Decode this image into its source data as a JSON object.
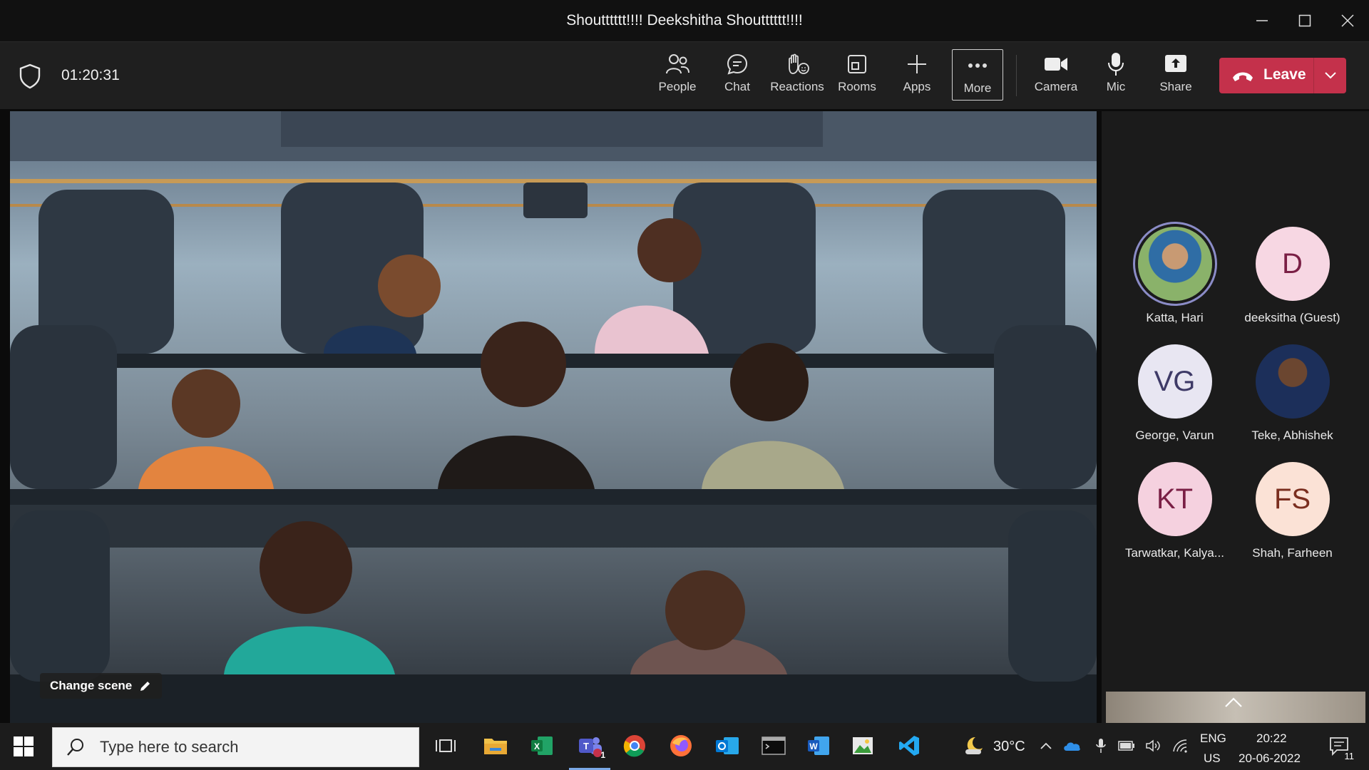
{
  "window": {
    "title": "Shoutttttt!!!! Deekshitha Shoutttttt!!!!"
  },
  "meeting": {
    "timer": "01:20:31",
    "tools": [
      {
        "label": "People",
        "icon": "people-icon"
      },
      {
        "label": "Chat",
        "icon": "chat-icon"
      },
      {
        "label": "Reactions",
        "icon": "reactions-icon"
      },
      {
        "label": "Rooms",
        "icon": "rooms-icon"
      },
      {
        "label": "Apps",
        "icon": "apps-plus-icon"
      },
      {
        "label": "More",
        "icon": "more-dots-icon"
      },
      {
        "label": "Camera",
        "icon": "camera-icon"
      },
      {
        "label": "Mic",
        "icon": "mic-icon"
      },
      {
        "label": "Share",
        "icon": "share-icon"
      }
    ],
    "leave_label": "Leave",
    "accent": "#c4314b"
  },
  "stage": {
    "change_scene_label": "Change scene"
  },
  "roster": {
    "participants": [
      {
        "name": "Katta, Hari",
        "initials": "",
        "kind": "photo"
      },
      {
        "name": "deeksitha (Guest)",
        "initials": "D",
        "kind": "initials"
      },
      {
        "name": "George, Varun",
        "initials": "VG",
        "kind": "initials"
      },
      {
        "name": "Teke, Abhishek",
        "initials": "",
        "kind": "photo"
      },
      {
        "name": "Tarwatkar, Kalya...",
        "initials": "KT",
        "kind": "initials"
      },
      {
        "name": "Shah, Farheen",
        "initials": "FS",
        "kind": "initials"
      }
    ]
  },
  "taskbar": {
    "search_placeholder": "Type here to search",
    "weather_temp": "30°C",
    "lang_top": "ENG",
    "lang_bottom": "US",
    "time": "20:22",
    "date": "20-06-2022",
    "notification_count": "11",
    "teams_badge": "1"
  }
}
